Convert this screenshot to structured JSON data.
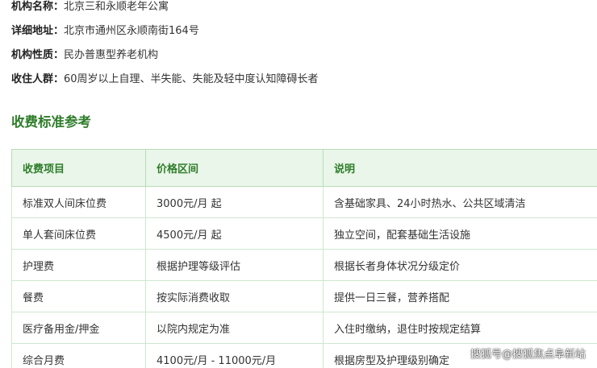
{
  "info": [
    {
      "label": "机构名称：",
      "value": "北京三和永顺老年公寓"
    },
    {
      "label": "详细地址：",
      "value": "北京市通州区永顺南街164号"
    },
    {
      "label": "机构性质：",
      "value": "民办普惠型养老机构"
    },
    {
      "label": "收住人群：",
      "value": "60周岁以上自理、半失能、失能及轻中度认知障碍长者"
    }
  ],
  "section_title": "收费标准参考",
  "table": {
    "headers": [
      "收费项目",
      "价格区间",
      "说明"
    ],
    "rows": [
      [
        "标准双人间床位费",
        "3000元/月 起",
        "含基础家具、24小时热水、公共区域清洁"
      ],
      [
        "单人套间床位费",
        "4500元/月 起",
        "独立空间，配套基础生活设施"
      ],
      [
        "护理费",
        "根据护理等级评估",
        "根据长者身体状况分级定价"
      ],
      [
        "餐费",
        "按实际消费收取",
        "提供一日三餐，营养搭配"
      ],
      [
        "医疗备用金/押金",
        "以院内规定为准",
        "入住时缴纳，退住时按规定结算"
      ],
      [
        "综合月费",
        "4100元/月 - 11000元/月",
        "根据房型及护理级别确定"
      ]
    ]
  },
  "watermark": "搜狐号@搜狐焦点阜新站",
  "colors": {
    "accent_green": "#2f7d2b",
    "header_bg": "#e9f6e9",
    "border": "#cfe6cf"
  }
}
